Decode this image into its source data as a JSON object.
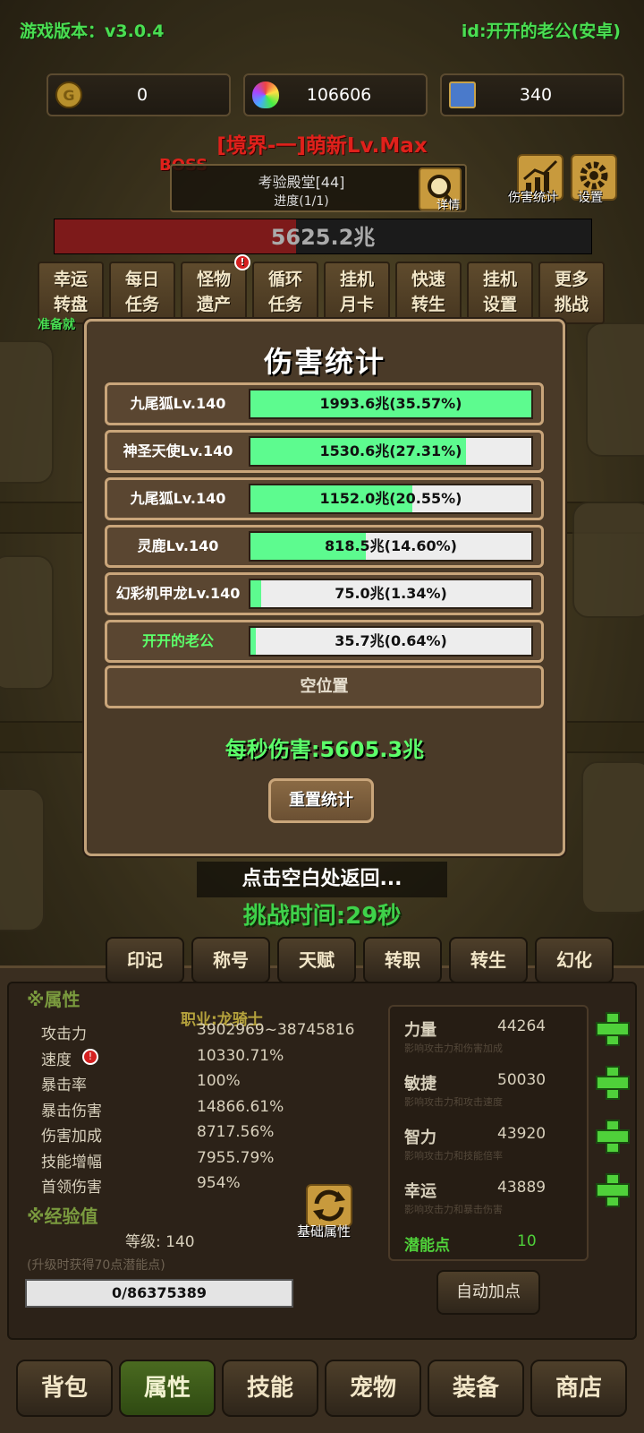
{
  "header": {
    "version": "游戏版本：v3.0.4",
    "user_id": "id:开开的老公(安卓)"
  },
  "resources": [
    {
      "icon": "gold-coin-icon",
      "value": "0"
    },
    {
      "icon": "rainbow-egg-icon",
      "value": "106606"
    },
    {
      "icon": "card-icon",
      "value": "340"
    }
  ],
  "realm": "[境界-一]萌新Lv.Max",
  "stage": {
    "boss_tag": "BOSS",
    "name": "考验殿堂[44]",
    "progress": "进度(1/1)",
    "detail_label": "详情",
    "hp_text": "5625.2兆",
    "hp_fraction": 0.45
  },
  "top_icons": {
    "damage_stats": "伤害统计",
    "settings": "设置"
  },
  "functions": [
    {
      "label": "幸运\n转盘"
    },
    {
      "label": "每日\n任务"
    },
    {
      "label": "怪物\n遗产",
      "alert": "!"
    },
    {
      "label": "循环\n任务"
    },
    {
      "label": "挂机\n月卡"
    },
    {
      "label": "快速\n转生"
    },
    {
      "label": "挂机\n设置"
    },
    {
      "label": "更多\n挑战"
    }
  ],
  "ready_text": "准备就",
  "modal": {
    "title": "伤害统计",
    "rows": [
      {
        "name": "九尾狐Lv.140",
        "value": "1993.6兆(35.57%)",
        "fraction": 1.0,
        "highlight": false
      },
      {
        "name": "神圣天使Lv.140",
        "value": "1530.6兆(27.31%)",
        "fraction": 0.767,
        "highlight": false
      },
      {
        "name": "九尾狐Lv.140",
        "value": "1152.0兆(20.55%)",
        "fraction": 0.578,
        "highlight": false
      },
      {
        "name": "灵鹿Lv.140",
        "value": "818.5兆(14.60%)",
        "fraction": 0.41,
        "highlight": false
      },
      {
        "name": "幻彩机甲龙Lv.140",
        "value": "75.0兆(1.34%)",
        "fraction": 0.038,
        "highlight": false
      },
      {
        "name": "开开的老公",
        "value": "35.7兆(0.64%)",
        "fraction": 0.018,
        "highlight": true
      }
    ],
    "empty_slot": "空位置",
    "dps": "每秒伤害:5605.3兆",
    "reset": "重置统计"
  },
  "tap_hint": "点击空白处返回...",
  "challenge_time": "挑战时间:29秒",
  "tabs": [
    "印记",
    "称号",
    "天赋",
    "转职",
    "转生",
    "幻化"
  ],
  "attributes": {
    "title": "※属性",
    "job": "职业:龙骑士",
    "items": [
      {
        "name": "攻击力",
        "value": "3902969~38745816"
      },
      {
        "name": "速度",
        "value": "10330.71%",
        "alert": "!"
      },
      {
        "name": "暴击率",
        "value": "100%"
      },
      {
        "name": "暴击伤害",
        "value": "14866.61%"
      },
      {
        "name": "伤害加成",
        "value": "8717.56%"
      },
      {
        "name": "技能增幅",
        "value": "7955.79%"
      },
      {
        "name": "首领伤害",
        "value": "954%"
      }
    ],
    "switch_label": "基础属性"
  },
  "experience": {
    "title": "※经验值",
    "level": "等级: 140",
    "note": "(升级时获得70点潜能点)",
    "bar": "0/86375389"
  },
  "stats": [
    {
      "name": "力量",
      "value": "44264",
      "desc": "影响攻击力和伤害加成"
    },
    {
      "name": "敏捷",
      "value": "50030",
      "desc": "影响攻击力和攻击速度"
    },
    {
      "name": "智力",
      "value": "43920",
      "desc": "影响攻击力和技能倍率"
    },
    {
      "name": "幸运",
      "value": "43889",
      "desc": "影响攻击力和暴击伤害"
    }
  ],
  "potential": {
    "name": "潜能点",
    "value": "10"
  },
  "auto_assign": "自动加点",
  "nav": [
    {
      "label": "背包",
      "active": false
    },
    {
      "label": "属性",
      "active": true
    },
    {
      "label": "技能",
      "active": false
    },
    {
      "label": "宠物",
      "active": false
    },
    {
      "label": "装备",
      "active": false
    },
    {
      "label": "商店",
      "active": false
    }
  ]
}
